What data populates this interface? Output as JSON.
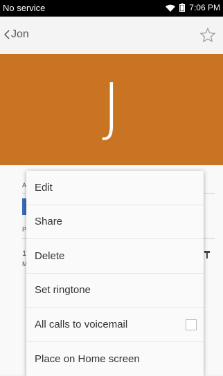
{
  "status_bar": {
    "carrier": "No service",
    "time": "7:06 PM",
    "wifi_icon": "wifi-icon",
    "battery_icon": "battery-icon"
  },
  "toolbar": {
    "title": "Jon",
    "back_icon": "chevron-left-icon",
    "favorite_icon": "star-icon"
  },
  "contact": {
    "initial": "J",
    "color": "#c87422"
  },
  "background_fragments": {
    "row1": "A",
    "row2": "P",
    "row3": "1",
    "row3b": "M"
  },
  "menu": {
    "items": [
      {
        "label": "Edit"
      },
      {
        "label": "Share"
      },
      {
        "label": "Delete"
      },
      {
        "label": "Set ringtone"
      },
      {
        "label": "All calls to voicemail",
        "checked": false
      },
      {
        "label": "Place on Home screen"
      }
    ]
  }
}
